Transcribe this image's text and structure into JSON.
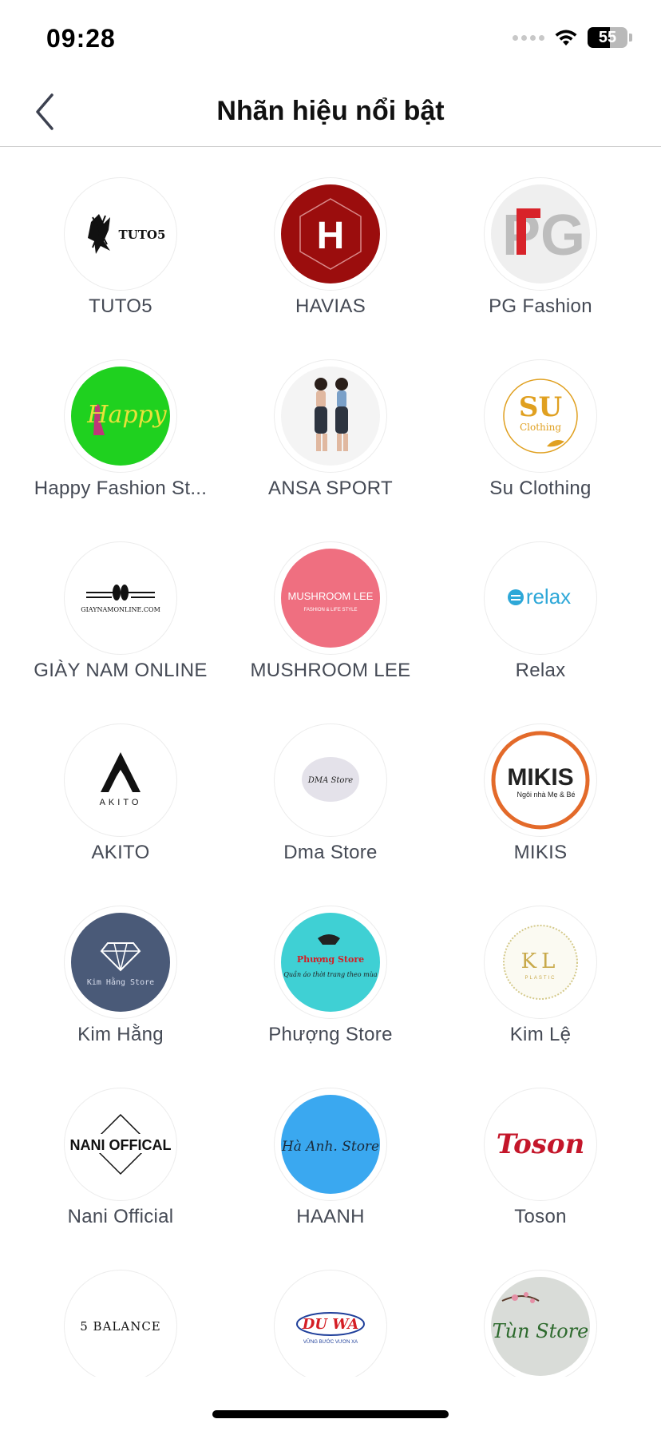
{
  "status": {
    "time": "09:28",
    "battery": "55",
    "battery_fraction": 0.55
  },
  "header": {
    "title": "Nhãn hiệu nổi bật"
  },
  "brands": [
    {
      "name": "TUTO5",
      "logo_text": "TUTO5"
    },
    {
      "name": "HAVIAS",
      "logo_text": "H"
    },
    {
      "name": "PG Fashion",
      "logo_text": "PG"
    },
    {
      "name": "Happy Fashion St...",
      "logo_text": "Happy"
    },
    {
      "name": "ANSA SPORT"
    },
    {
      "name": "Su Clothing",
      "logo_text": "SU",
      "logo_sub": "Clothing"
    },
    {
      "name": "GIÀY NAM ONLINE",
      "logo_text": "GIAYNAMONLINE.COM"
    },
    {
      "name": "MUSHROOM LEE",
      "logo_text": "MUSHROOM LEE",
      "logo_sub": "FASHION & LIFE STYLE"
    },
    {
      "name": "Relax",
      "logo_text": "relax"
    },
    {
      "name": "AKITO",
      "logo_text": "AKITO"
    },
    {
      "name": "Dma Store",
      "logo_text": "DMA Store"
    },
    {
      "name": "MIKIS",
      "logo_text": "MIKIS",
      "logo_sub": "Ngôi nhà Mẹ & Bé"
    },
    {
      "name": "Kim Hằng",
      "logo_text": "Kim Hằng Store"
    },
    {
      "name": "Phượng Store",
      "logo_text": "Phượng Store",
      "logo_sub": "Quần áo thời trang theo mùa"
    },
    {
      "name": "Kim Lệ",
      "logo_text": "KL",
      "logo_sub": "PLASTIC"
    },
    {
      "name": "Nani Official",
      "logo_text": "NANI OFFICAL"
    },
    {
      "name": "HAANH",
      "logo_text": "Hà Anh. Store"
    },
    {
      "name": "Toson",
      "logo_text": "Toson"
    },
    {
      "name": "",
      "logo_text": "5 BALANCE"
    },
    {
      "name": "",
      "logo_text": "DU WA",
      "logo_sub": "VỮNG BƯỚC VƯƠN XA"
    },
    {
      "name": "",
      "logo_text": "Tùn Store"
    }
  ],
  "colors": {
    "havias": "#9b0d0d",
    "happy": "#1fd11f",
    "mushroom": "#ef6f80",
    "relax": "#2ea8d8",
    "su": "#e0a020",
    "mikis": "#e36a2a",
    "kim_hang": "#4a5a78",
    "phuong": "#3fd0d4",
    "haanh": "#3aa8f0",
    "toson": "#c4162a",
    "duwa": "#d41e25"
  }
}
